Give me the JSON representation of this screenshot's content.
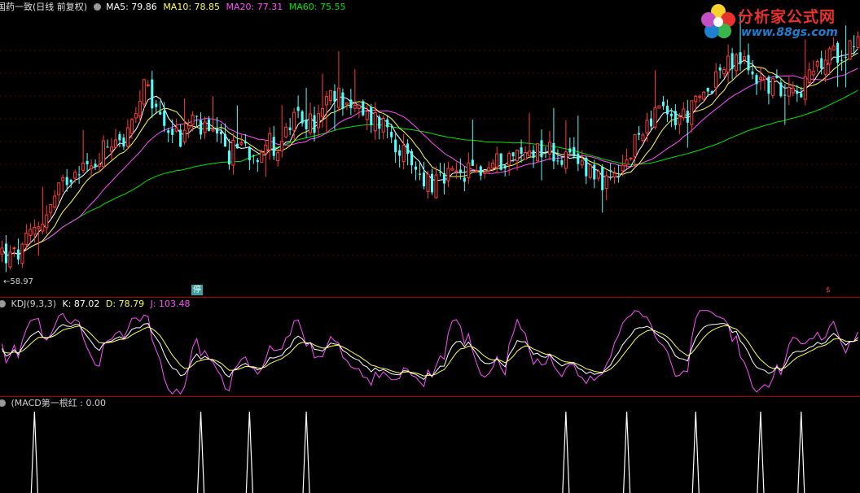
{
  "header": {
    "title": "国药一致(日线 前复权)",
    "ma5_label": "MA5: 79.86",
    "ma10_label": "MA10: 78.85",
    "ma20_label": "MA20: 77.31",
    "ma60_label": "MA60: 75.55"
  },
  "colors": {
    "up": "#ff3c3c",
    "down": "#54fcfc",
    "ma5": "#ffffff",
    "ma10": "#ffff50",
    "ma20": "#ff50ff",
    "ma60": "#00e600",
    "divider": "#b00000",
    "grid": "#5a0000",
    "kdj_k": "#ffffff",
    "kdj_d": "#ffff50",
    "kdj_j": "#ff50ff"
  },
  "price_panel": {
    "low_marker": "58.97",
    "stop_badge": "停"
  },
  "kdj_panel": {
    "name_label": "KDJ(9,3,3)",
    "k_label": "K: 87.02",
    "d_label": "D: 78.79",
    "j_label": "J: 103.48"
  },
  "macd_panel": {
    "name_label": "(MACD第一根红 : 0.00"
  },
  "logo": {
    "text": "分析家公式网",
    "url": "www.88gs.com"
  },
  "chart_data": [
    {
      "type": "candlestick",
      "title": "国药一致(日线 前复权)",
      "series": [
        {
          "name": "MA5",
          "value": 79.86
        },
        {
          "name": "MA10",
          "value": 78.85
        },
        {
          "name": "MA20",
          "value": 77.31
        },
        {
          "name": "MA60",
          "value": 75.55
        }
      ],
      "annotations": [
        "58.97",
        "停"
      ],
      "anchors": {
        "low": 58.97,
        "last_close_approx": 82.0
      },
      "close_path": [
        [
          0,
          62
        ],
        [
          2,
          61
        ],
        [
          5,
          62
        ],
        [
          8,
          65
        ],
        [
          12,
          68
        ],
        [
          14,
          70
        ],
        [
          16,
          72
        ],
        [
          19,
          74
        ],
        [
          22,
          73
        ],
        [
          25,
          76
        ],
        [
          28,
          78
        ],
        [
          30,
          77
        ],
        [
          33,
          80
        ],
        [
          35,
          84
        ],
        [
          38,
          81
        ],
        [
          41,
          79
        ],
        [
          44,
          77
        ],
        [
          47,
          80
        ],
        [
          50,
          78
        ],
        [
          53,
          77
        ],
        [
          56,
          75
        ],
        [
          59,
          77
        ],
        [
          62,
          75
        ],
        [
          65,
          77
        ],
        [
          68,
          76
        ],
        [
          71,
          79
        ],
        [
          74,
          80
        ],
        [
          77,
          79
        ],
        [
          80,
          82
        ],
        [
          83,
          83
        ],
        [
          86,
          82
        ],
        [
          89,
          80
        ],
        [
          92,
          80
        ],
        [
          95,
          79
        ],
        [
          98,
          76
        ],
        [
          101,
          73
        ],
        [
          104,
          72
        ],
        [
          107,
          71
        ],
        [
          110,
          72
        ],
        [
          113,
          72
        ],
        [
          116,
          73
        ],
        [
          119,
          73
        ],
        [
          122,
          74
        ],
        [
          125,
          75
        ],
        [
          128,
          75
        ],
        [
          131,
          76
        ],
        [
          134,
          76
        ],
        [
          137,
          75
        ],
        [
          140,
          74
        ],
        [
          143,
          74
        ],
        [
          146,
          73
        ],
        [
          149,
          71
        ],
        [
          152,
          72
        ],
        [
          155,
          75
        ],
        [
          158,
          79
        ],
        [
          161,
          81
        ],
        [
          164,
          80
        ],
        [
          167,
          80
        ],
        [
          170,
          81
        ],
        [
          173,
          83
        ],
        [
          176,
          86
        ],
        [
          179,
          87
        ],
        [
          182,
          88
        ],
        [
          185,
          86
        ],
        [
          188,
          85
        ],
        [
          191,
          84
        ],
        [
          194,
          85
        ],
        [
          197,
          84
        ],
        [
          200,
          86
        ],
        [
          203,
          88
        ],
        [
          206,
          89
        ],
        [
          209,
          90
        ],
        [
          212,
          92
        ]
      ],
      "candle_count": 212
    },
    {
      "type": "line",
      "title": "KDJ(9,3,3)",
      "series": [
        {
          "name": "K",
          "last": 87.02
        },
        {
          "name": "D",
          "last": 78.79
        },
        {
          "name": "J",
          "last": 103.48
        }
      ]
    },
    {
      "type": "bar",
      "title": "MACD第一根红",
      "value": 0.0,
      "signal_bars": [
        8,
        49,
        61,
        75,
        139,
        154,
        171,
        187,
        197
      ]
    }
  ]
}
